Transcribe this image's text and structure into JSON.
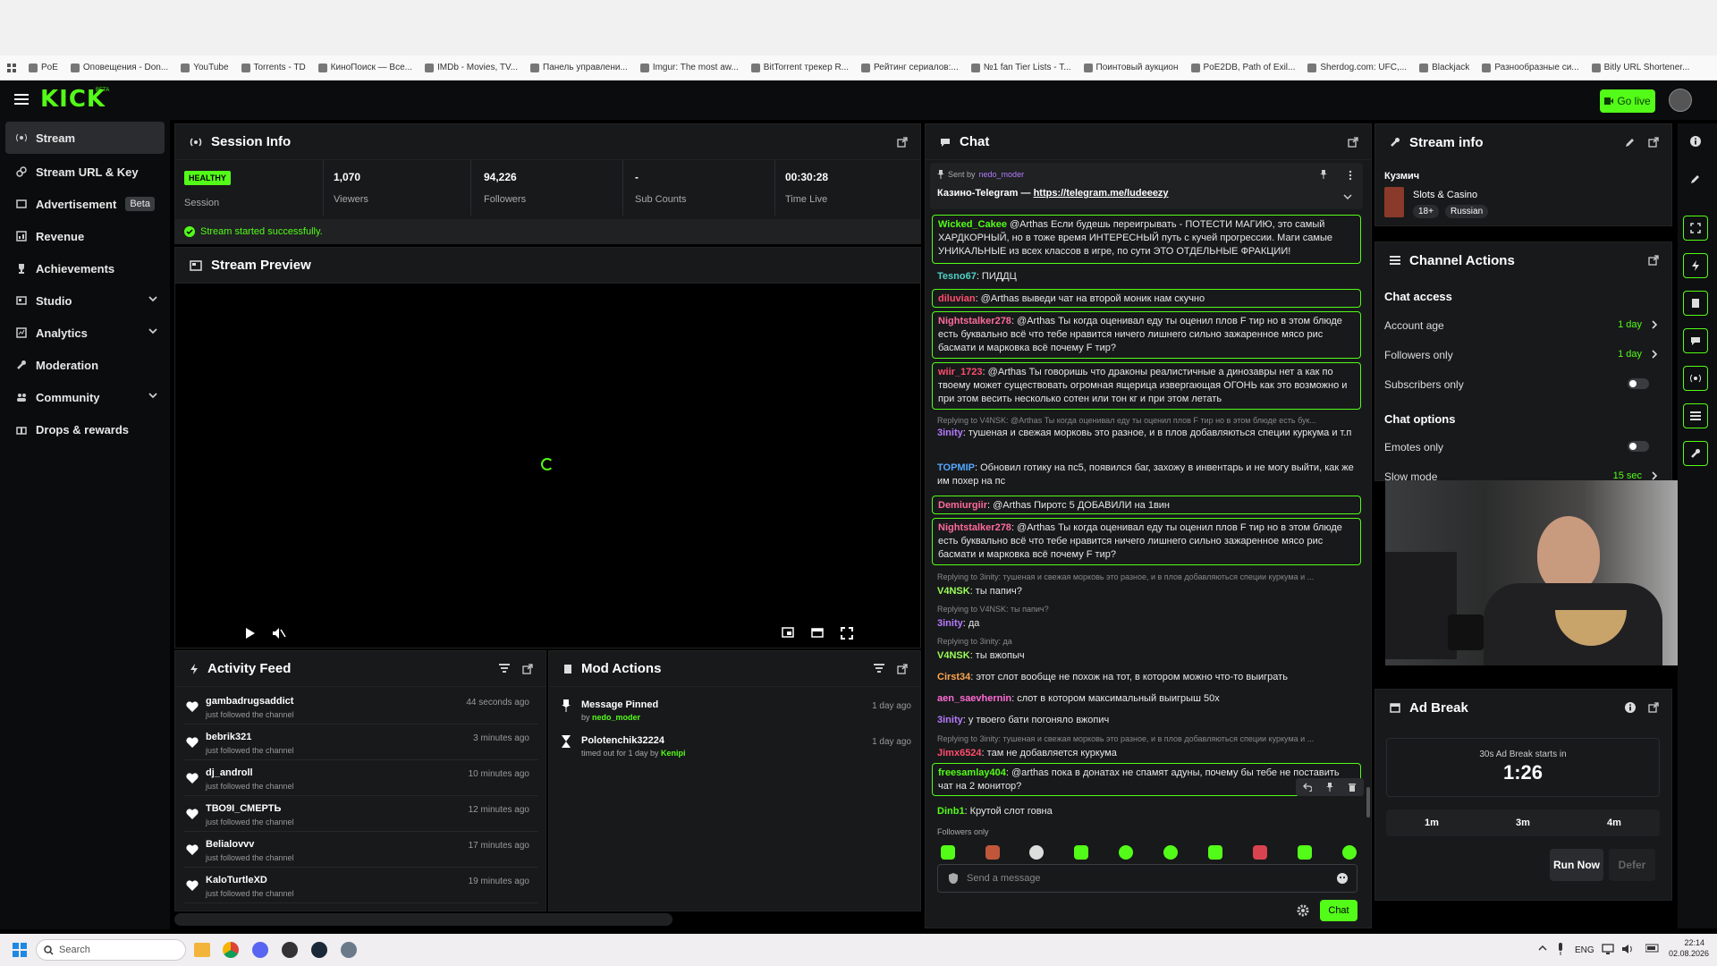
{
  "browser": {
    "bookmarks": [
      "PoE",
      "Оповещения - Don...",
      "YouTube",
      "Torrents - TD",
      "КиноПоиск — Все...",
      "IMDb - Movies, TV...",
      "Панель управлени...",
      "Imgur: The most aw...",
      "BitTorrent трекер R...",
      "Рейтинг сериалов:...",
      "№1 fan Tier Lists - T...",
      "Поинтовый аукцион",
      "PoE2DB, Path of Exil...",
      "Sherdog.com: UFC,...",
      "Blackjack",
      "Разнообразные си...",
      "Bitly URL Shortener..."
    ]
  },
  "header": {
    "logo": "KICK",
    "logo_badge": "BETA",
    "golive_label": "Go live"
  },
  "sidebar": {
    "items": [
      {
        "label": "Stream"
      },
      {
        "label": "Stream URL & Key"
      },
      {
        "label": "Advertisement",
        "badge": "Beta"
      },
      {
        "label": "Revenue"
      },
      {
        "label": "Achievements"
      },
      {
        "label": "Studio"
      },
      {
        "label": "Analytics"
      },
      {
        "label": "Moderation"
      },
      {
        "label": "Community"
      },
      {
        "label": "Drops & rewards"
      }
    ]
  },
  "session": {
    "title": "Session Info",
    "health_badge": "HEALTHY",
    "session_label": "Session",
    "stats": [
      {
        "value": "1,070",
        "label": "Viewers"
      },
      {
        "value": "94,226",
        "label": "Followers"
      },
      {
        "value": "-",
        "label": "Sub Counts"
      },
      {
        "value": "00:30:28",
        "label": "Time Live"
      }
    ],
    "status": "Stream started successfully."
  },
  "preview": {
    "title": "Stream Preview"
  },
  "activity": {
    "title": "Activity Feed",
    "items": [
      {
        "name": "gambadrugsaddict",
        "sub": "just followed the channel",
        "time": "44 seconds ago"
      },
      {
        "name": "bebrik321",
        "sub": "just followed the channel",
        "time": "3 minutes ago"
      },
      {
        "name": "dj_androll",
        "sub": "just followed the channel",
        "time": "10 minutes ago"
      },
      {
        "name": "ТВО9I_СМЕРТЬ",
        "sub": "just followed the channel",
        "time": "12 minutes ago"
      },
      {
        "name": "Belialovvv",
        "sub": "just followed the channel",
        "time": "17 minutes ago"
      },
      {
        "name": "KaloTurtleXD",
        "sub": "just followed the channel",
        "time": "19 minutes ago"
      }
    ]
  },
  "modactions": {
    "title": "Mod Actions",
    "items": [
      {
        "title": "Message Pinned",
        "by": "by ",
        "who": "nedo_moder",
        "time": "1 day ago"
      },
      {
        "title": "Polotenchik32224",
        "by": "timed out for 1 day by ",
        "who": "Kenipi",
        "time": "1 day ago"
      }
    ]
  },
  "chat": {
    "title": "Chat",
    "pinned": {
      "sent_by": "Sent by",
      "user": "nedo_moder",
      "text": "Казино-Telegram — ",
      "link": "https://telegram.me/ludeeezy"
    },
    "messages": [
      {
        "user": "Wicked_Cakee",
        "text": " @Arthas Если будешь переигрывать - ПОТЕСТИ МАГИЮ, это самый ХАРДКОРНЫЙ, но в тоже время ИНТЕРЕСНЫЙ путь с кучей прогрессии. Маги самые УНИКАЛЬНЫЕ из всех классов в игре, по сути ЭТО ОТДЕЛЬНЫЕ ФРАКЦИИ!",
        "color": "#53fc18"
      },
      {
        "user": "Tesno67",
        "text": ": ПИДДЦ",
        "color": "#4fd1c5"
      },
      {
        "user": "diluvian",
        "text": ": @Arthas выведи чат на второй моник нам скучно",
        "color": "#ff4d6d"
      },
      {
        "user": "Nightstalker278",
        "text": ": @Arthas Ты когда оценивал еду ты оценил плов F тир но в этом блюде есть буквально всё что тебе нравится ничего лишнего сильно зажаренное мясо рис басмати и марковка всё почему F тир?",
        "color": "#ff6b9a"
      },
      {
        "user": "wiir_1723",
        "text": ": @Arthas Ты говоришь что драконы реалистичные а динозавры нет а как по твоему может существовать огромная ящерица изверга­ющая ОГОНЬ как это возможно и при этом весить несколько сотен или тон кг и при этом летать",
        "color": "#ff4d6d"
      },
      {
        "reply": "Replying to V4NSK: @Arthas Ты когда оценивал еду ты оценил плов F тир но в этом блюде есть бук..."
      },
      {
        "user": "3inity",
        "text": ": тушеная и свежая морковь это разное, и в плов добавляються специи куркума и т.п",
        "color": "#b57bff"
      },
      {
        "user": "TOPMIP",
        "text": ": Обновил готику на пс5, появился баг, захожу в инвентарь и не могу выйти, как же им похер на пс",
        "color": "#53a7ff"
      },
      {
        "user": "Demiurgiir",
        "text": ": @Arthas Пиротс 5 ДОБАВИЛИ на 1вин",
        "color": "#ff6b9a"
      },
      {
        "user": "Nightstalker278",
        "text": ": @Arthas Ты когда оценивал еду ты оценил плов F тир но в этом блюде есть буквально всё что тебе нравится ничего лишнего сильно зажаренное мясо рис басмати и марковка всё почему F тир?",
        "color": "#ff6b9a"
      },
      {
        "reply": "Replying to 3inity: тушеная и свежая морковь это разное, и в плов добавляються специи куркума и ..."
      },
      {
        "user": "V4NSK",
        "text": ": ты папич?",
        "color": "#9bff57"
      },
      {
        "reply": "Replying to V4NSK: ты папич?"
      },
      {
        "user": "3inity",
        "text": ": да",
        "color": "#b57bff"
      },
      {
        "reply": "Replying to 3inity: да"
      },
      {
        "user": "V4NSK",
        "text": ": ты вжопыч",
        "color": "#9bff57"
      },
      {
        "user": "Cirst34",
        "text": ": этот слот вообще не похож на тот, в котором можно что-то выиграть",
        "color": "#ffa64d"
      },
      {
        "user": "aen_saevhernin",
        "text": ": слот в котором максимальный выигрыш 50х",
        "color": "#ff6bd5"
      },
      {
        "user": "3inity",
        "text": ": у твоего бати погоняло вжопич",
        "color": "#b57bff"
      },
      {
        "reply": "Replying to 3inity: тушеная и свежая морковь это разное, и в плов добавляються специи куркума и ..."
      },
      {
        "user": "Jimx6524",
        "text": ": там не добавляется куркума",
        "color": "#ff4d6d"
      },
      {
        "user": "freesamlay404",
        "text": ": @arthas пока в донатах не спамят адуны, почему бы тебе не поставить чат на 2 монитор?",
        "color": "#53fc18"
      },
      {
        "user": "Dinb1",
        "text": ": Крутой слот говна",
        "color": "#53fc18"
      }
    ],
    "followers_only": "Followers only",
    "placeholder": "Send a message",
    "send_label": "Chat"
  },
  "streaminfo": {
    "title": "Stream info",
    "streamer": "Кузмич",
    "category": "Slots & Casino",
    "tags": [
      "18+",
      "Russian"
    ]
  },
  "channel_actions": {
    "title": "Channel Actions",
    "chat_access": "Chat access",
    "account_age": {
      "label": "Account age",
      "value": "1 day"
    },
    "followers_only": {
      "label": "Followers only",
      "value": "1 day"
    },
    "subscribers_only": {
      "label": "Subscribers only"
    },
    "chat_options": "Chat options",
    "emotes_only": {
      "label": "Emotes only"
    },
    "slow_mode": {
      "label": "Slow mode",
      "value": "15 sec"
    }
  },
  "adbreak": {
    "title": "Ad Break",
    "caption": "30s Ad Break starts in",
    "countdown": "1:26",
    "options": [
      "1m",
      "3m",
      "4m"
    ],
    "run_now": "Run Now",
    "defer": "Defer"
  },
  "taskbar": {
    "search_placeholder": "Search",
    "lang": "ENG",
    "time": "22:14",
    "date": "02.08.2026"
  },
  "colors": {
    "accent": "#53fc18",
    "panel": "#18191b",
    "bg": "#000000"
  }
}
